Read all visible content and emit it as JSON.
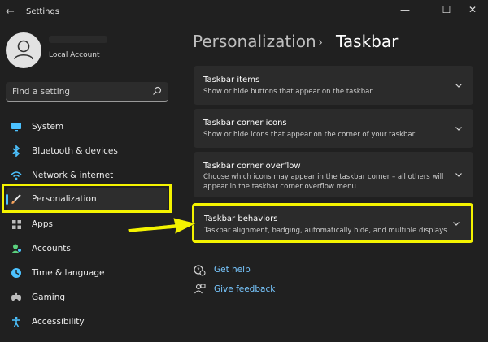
{
  "window": {
    "title": "Settings",
    "controls": {
      "minimize": "—",
      "maximize": "☐",
      "close": "✕"
    }
  },
  "account": {
    "name": "Local Account"
  },
  "search": {
    "placeholder": "Find a setting"
  },
  "sidebar": {
    "items": [
      {
        "label": "System",
        "icon": "monitor-icon",
        "color": "#4cc2ff"
      },
      {
        "label": "Bluetooth & devices",
        "icon": "bluetooth-icon",
        "color": "#4cc2ff"
      },
      {
        "label": "Network & internet",
        "icon": "wifi-icon",
        "color": "#4cc2ff"
      },
      {
        "label": "Personalization",
        "icon": "brush-icon",
        "color": "#f7a35c",
        "active": true
      },
      {
        "label": "Apps",
        "icon": "apps-icon",
        "color": "#bcbcbc"
      },
      {
        "label": "Accounts",
        "icon": "person-icon",
        "color": "#5ad17e"
      },
      {
        "label": "Time & language",
        "icon": "globe-clock-icon",
        "color": "#4cc2ff"
      },
      {
        "label": "Gaming",
        "icon": "gamepad-icon",
        "color": "#bcbcbc"
      },
      {
        "label": "Accessibility",
        "icon": "accessibility-icon",
        "color": "#4cc2ff"
      }
    ]
  },
  "header": {
    "parent": "Personalization",
    "separator": "›",
    "current": "Taskbar"
  },
  "cards": [
    {
      "title": "Taskbar items",
      "desc": "Show or hide buttons that appear on the taskbar"
    },
    {
      "title": "Taskbar corner icons",
      "desc": "Show or hide icons that appear on the corner of your taskbar"
    },
    {
      "title": "Taskbar corner overflow",
      "desc": "Choose which icons may appear in the taskbar corner – all others will appear in the taskbar corner overflow menu"
    },
    {
      "title": "Taskbar behaviors",
      "desc": "Taskbar alignment, badging, automatically hide, and multiple displays",
      "highlighted": true
    }
  ],
  "links": [
    {
      "label": "Get help",
      "icon": "help-icon"
    },
    {
      "label": "Give feedback",
      "icon": "feedback-icon"
    }
  ],
  "annotation": {
    "highlight_color": "#f4f300",
    "arrow_color": "#f4f300"
  }
}
